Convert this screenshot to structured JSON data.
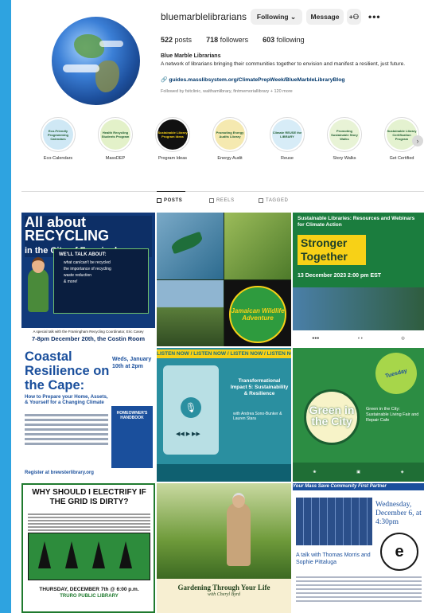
{
  "profile": {
    "username": "bluemarblelibrarians",
    "following_label": "Following ⌄",
    "message_label": "Message",
    "add_user_glyph": "+⚇",
    "more_glyph": "•••",
    "posts_count": "522",
    "posts_label": "posts",
    "followers_count": "718",
    "followers_label": "followers",
    "following_count": "603",
    "following_stat_label": "following",
    "name": "Blue Marble Librarians",
    "bio": "A network of librarians bringing their communities together to envision and manifest a resilient, just future.",
    "link": "guides.masslibsystem.org/ClimatePrepWeek/BlueMarbleLibraryBlog",
    "followed_by": "Followed by fsitclinic, walthamlibrary, fintmemoriallibrary + 120 more"
  },
  "highlights": [
    {
      "label": "Eco-Calendars",
      "inner": "Eco-Friendly Programming Calendars",
      "bg": "#cfe8f5"
    },
    {
      "label": "MassDEP",
      "inner": "Health Recycling Students Program",
      "bg": "#e3f1c9"
    },
    {
      "label": "Program Ideas",
      "inner": "Sustainable Library Program Ideas",
      "bg": "#111111"
    },
    {
      "label": "Energy Audit",
      "inner": "Promoting Energy Audits Library",
      "bg": "#f5e9b0"
    },
    {
      "label": "Reuse",
      "inner": "Climate REUSE the LIBRARY",
      "bg": "#d7ecf7"
    },
    {
      "label": "Story Walks",
      "inner": "Promoting Sustainable Story Walks",
      "bg": "#e8f3d6"
    },
    {
      "label": "Get Certified",
      "inner": "Sustainable Library Certification Program",
      "bg": "#e4f2d0"
    }
  ],
  "tabs": {
    "posts": "POSTS",
    "reels": "REELS",
    "tagged": "TAGGED"
  },
  "posts": {
    "p1": {
      "title_a": "All about",
      "title_b": "RECYCLING",
      "title_c": "in the City of Framingham",
      "box_header": "WE'LL TALK ABOUT:",
      "items": [
        "what can/can't be recycled",
        "the importance of recycling",
        "waste reduction",
        "& more!"
      ],
      "footer_a": "A special talk with the Framingham Recycling Coordinator, Eric Casey",
      "footer_b": "7-8pm December 20th, the Costin Room"
    },
    "p2": {
      "circle": "Jamaican Wildlife Adventure"
    },
    "p3": {
      "top": "Sustainable Libraries: Resources and Webinars for Climate Action",
      "title": "Stronger Together",
      "date": "13 December 2023  2:00 pm EST"
    },
    "p4": {
      "title": "Coastal Resilience on the Cape:",
      "when": "Weds, January 10th at 2pm",
      "sub": "How to Prepare your Home, Assets, & Yourself for a Changing Climate",
      "book": "HOMEOWNER'S HANDBOOK",
      "reg": "Register at brewsterlibrary.org"
    },
    "p5": {
      "banner": "LISTEN NOW / LISTEN NOW / LISTEN NOW / LISTEN NOW /",
      "right_title": "Transformational Impact 5: Sustainability & Resilience",
      "by": "with Andrea Sono-Bunker & Lauren Stara"
    },
    "p6": {
      "bubble": "Tuesday",
      "jar": "Green in the City",
      "side": "Green in the City: Sustainable Living Fair and Repair Cafe"
    },
    "p7": {
      "question": "WHY SHOULD I ELECTRIFY IF THE GRID IS DIRTY?",
      "date": "THURSDAY, DECEMBER 7th @ 6:00 p.m.",
      "lib": "TRURO PUBLIC LIBRARY"
    },
    "p8": {
      "title": "Gardening Through Your Life",
      "sub": "with Cheryl Byrd"
    },
    "p9": {
      "banner": "Your Mass Save Community First Partner",
      "date": "Wednesday, December 6, at 4:30pm",
      "logo": "e",
      "talk": "A talk with Thomas Morris and Sophie Pittaluga"
    }
  }
}
